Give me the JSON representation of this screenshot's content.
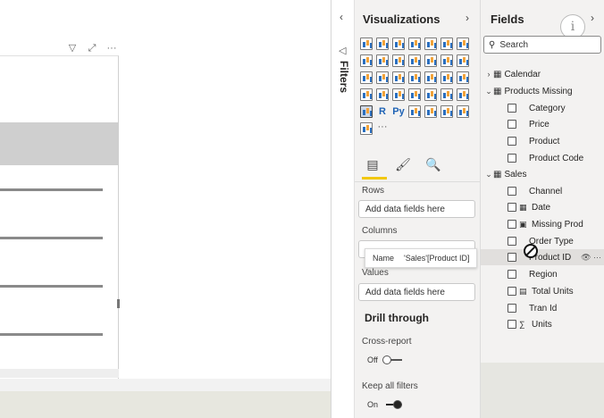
{
  "visual_header": {
    "filter_icon": "funnel-icon",
    "focus_icon": "focus-mode-icon",
    "more_label": "···"
  },
  "filters_pane": {
    "collapse_glyph": "‹",
    "label": "Filters"
  },
  "visualizations": {
    "title": "Visualizations",
    "expand_glyph": "›",
    "icons": [
      "stacked-bar-chart-icon",
      "stacked-column-chart-icon",
      "clustered-bar-chart-icon",
      "clustered-column-chart-icon",
      "100-bar-chart-icon",
      "100-column-chart-icon",
      "line-chart-icon",
      "area-chart-icon",
      "stacked-area-chart-icon",
      "line-column-chart-icon",
      "line-clustered-column-icon",
      "ribbon-chart-icon",
      "waterfall-chart-icon",
      "funnel-chart-icon",
      "scatter-chart-icon",
      "pie-chart-icon",
      "donut-chart-icon",
      "treemap-icon",
      "map-icon",
      "filled-map-icon",
      "shape-map-icon",
      "azure-map-icon",
      "gauge-icon",
      "card-icon",
      "multi-row-card-icon",
      "kpi-icon",
      "slicer-icon",
      "table-icon",
      "matrix-icon",
      "r-visual-icon",
      "python-visual-icon",
      "key-influencers-icon",
      "decomposition-tree-icon",
      "qa-icon",
      "smart-narrative-icon",
      "paginated-report-icon",
      "power-apps-icon",
      "more-visuals-icon"
    ],
    "r_label": "R",
    "py_label": "Py",
    "more_label": "···",
    "tabs": [
      "fields-tab-icon",
      "format-tab-icon",
      "analytics-tab-icon"
    ],
    "rows_label": "Rows",
    "rows_placeholder": "Add data fields here",
    "columns_label": "Columns",
    "values_label": "Values",
    "values_placeholder": "Add data fields here",
    "drill_through_title": "Drill through",
    "cross_report_label": "Cross-report",
    "cross_report_state": "Off",
    "keep_filters_label": "Keep all filters",
    "keep_filters_state": "On"
  },
  "tooltip": {
    "name_label": "Name",
    "name_value": "'Sales'[Product ID]"
  },
  "fields": {
    "title": "Fields",
    "expand_glyph": "›",
    "info_glyph": "i",
    "search_placeholder": "Search",
    "tables": [
      {
        "name": "Calendar",
        "expanded": false
      },
      {
        "name": "Products Missing",
        "expanded": true
      },
      {
        "name": "Sales",
        "expanded": true
      }
    ],
    "products_missing_fields": [
      "Category",
      "Price",
      "Product",
      "Product Code"
    ],
    "sales_fields": [
      "Channel",
      "Date",
      "Missing Prod",
      "Order Type",
      "Product ID",
      "Region",
      "Total Units",
      "Tran Id",
      "Units"
    ],
    "row_actions": "👁 ···"
  },
  "colors": {
    "accent_yellow": "#f2c811",
    "pane_bg": "#f3f2f1",
    "matrix_header": "#cfcfcf"
  }
}
